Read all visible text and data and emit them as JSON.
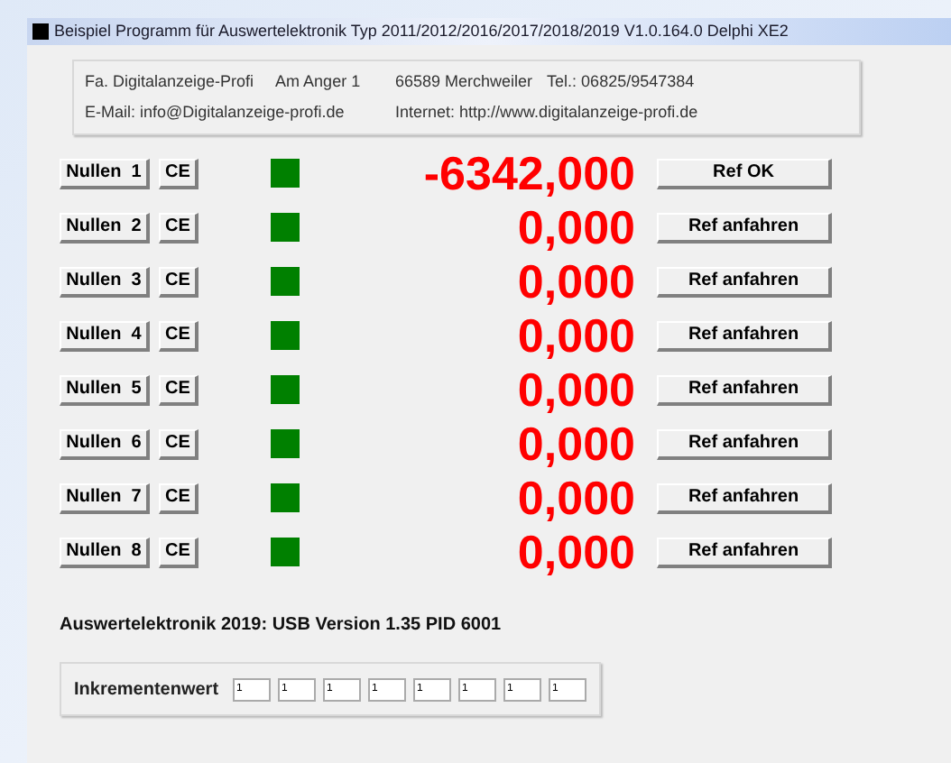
{
  "window": {
    "title": "Beispiel Programm für Auswertelektronik Typ 2011/2012/2016/2017/2018/2019 V1.0.164.0 Delphi XE2"
  },
  "info": {
    "company": "Fa. Digitalanzeige-Profi",
    "street": "Am Anger 1",
    "city": "66589 Merchweiler",
    "phone": "Tel.: 06825/9547384",
    "email": "E-Mail: info@Digitalanzeige-profi.de",
    "internet": "Internet: http://www.digitalanzeige-profi.de"
  },
  "channels": [
    {
      "zero_button": "Nullen  1",
      "ce_button": "CE",
      "color": "#008000",
      "value": "-6342,000",
      "ref_button": "Ref OK"
    },
    {
      "zero_button": "Nullen  2",
      "ce_button": "CE",
      "color": "#008000",
      "value": "0,000",
      "ref_button": "Ref anfahren"
    },
    {
      "zero_button": "Nullen  3",
      "ce_button": "CE",
      "color": "#008000",
      "value": "0,000",
      "ref_button": "Ref anfahren"
    },
    {
      "zero_button": "Nullen  4",
      "ce_button": "CE",
      "color": "#008000",
      "value": "0,000",
      "ref_button": "Ref anfahren"
    },
    {
      "zero_button": "Nullen  5",
      "ce_button": "CE",
      "color": "#008000",
      "value": "0,000",
      "ref_button": "Ref anfahren"
    },
    {
      "zero_button": "Nullen  6",
      "ce_button": "CE",
      "color": "#008000",
      "value": "0,000",
      "ref_button": "Ref anfahren"
    },
    {
      "zero_button": "Nullen  7",
      "ce_button": "CE",
      "color": "#008000",
      "value": "0,000",
      "ref_button": "Ref anfahren"
    },
    {
      "zero_button": "Nullen  8",
      "ce_button": "CE",
      "color": "#008000",
      "value": "0,000",
      "ref_button": "Ref anfahren"
    }
  ],
  "device_status": "Auswertelektronik 2019: USB Version 1.35 PID 6001",
  "increment": {
    "label": "Inkrementenwert",
    "values": [
      "1",
      "1",
      "1",
      "1",
      "1",
      "1",
      "1",
      "1"
    ]
  }
}
